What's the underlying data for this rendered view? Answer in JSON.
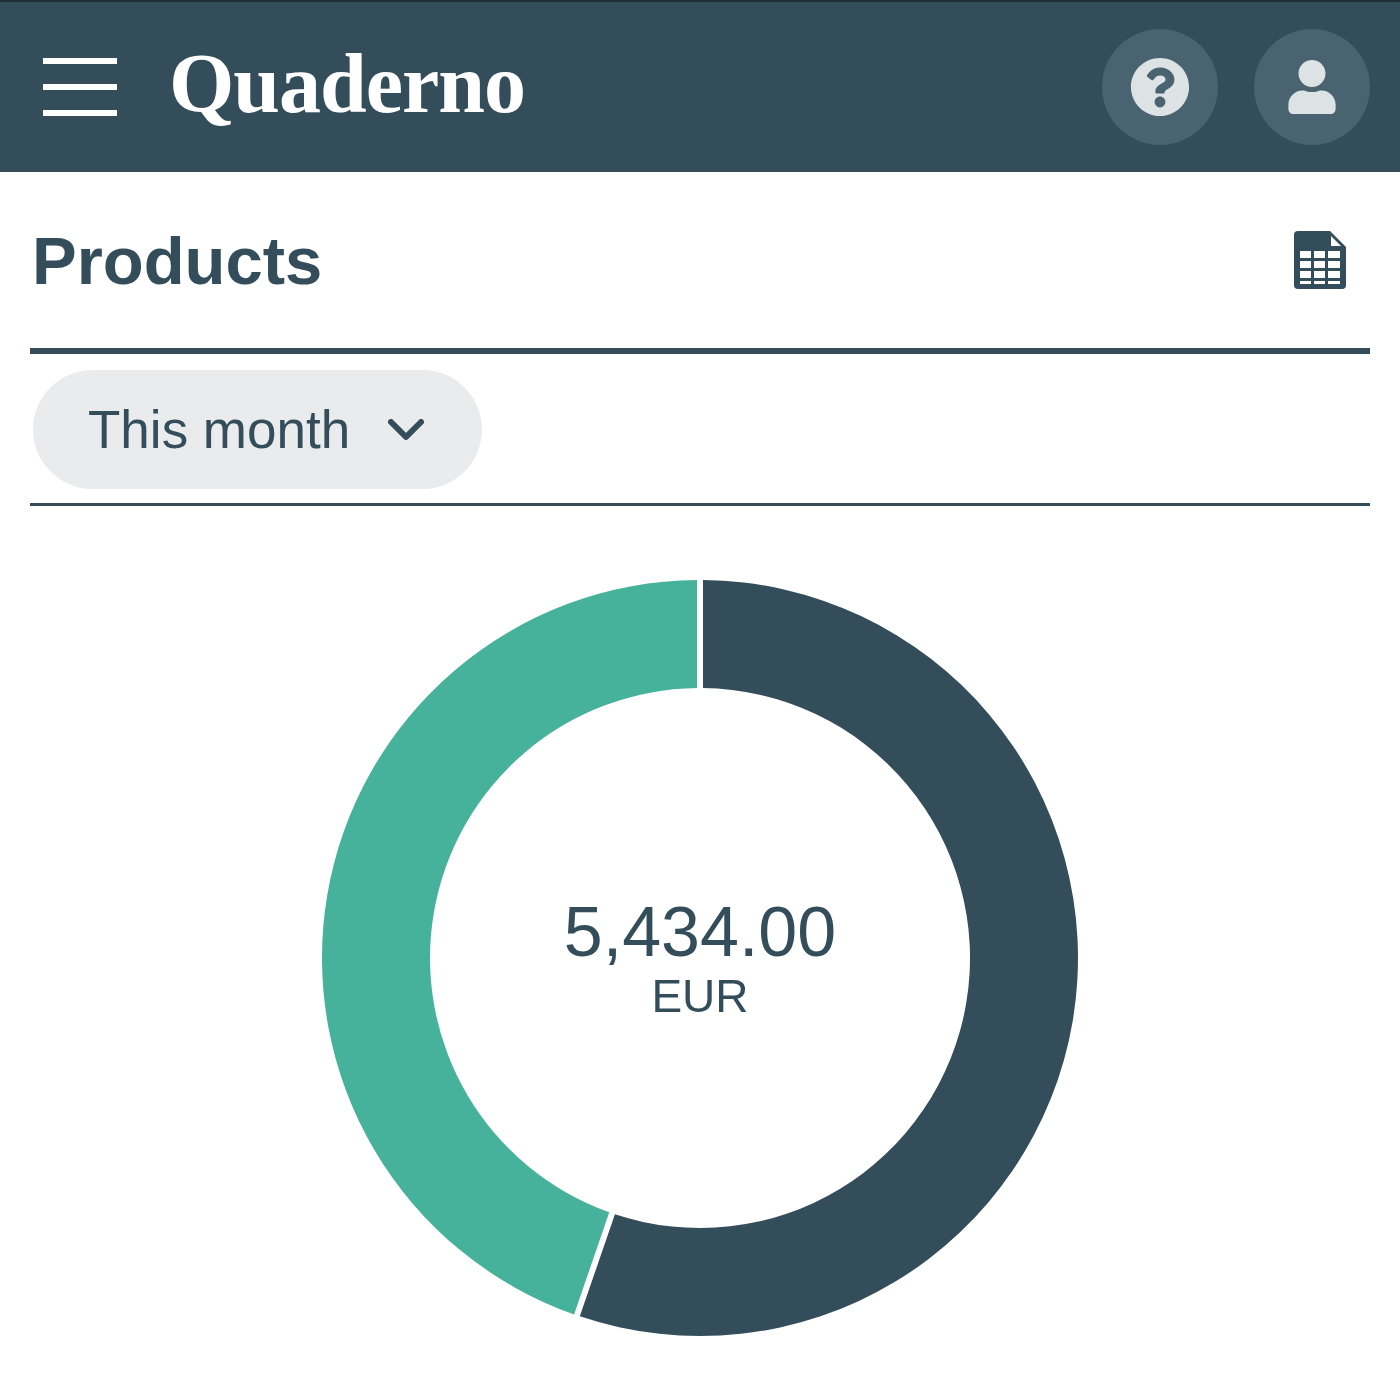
{
  "header": {
    "logo": "Quaderno"
  },
  "page": {
    "title": "Products"
  },
  "filter": {
    "label": "This month"
  },
  "summary": {
    "total": "5,434.00",
    "currency": "EUR"
  }
}
